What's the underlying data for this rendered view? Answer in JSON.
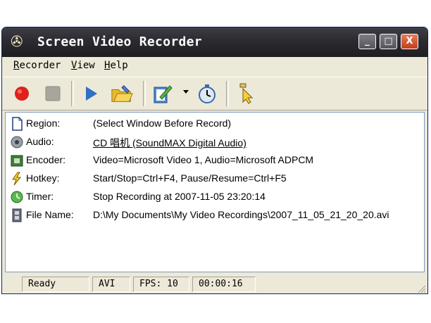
{
  "window": {
    "title": "Screen Video Recorder"
  },
  "menu": {
    "recorder": {
      "accel": "R",
      "rest": "ecorder"
    },
    "view": {
      "accel": "V",
      "rest": "iew"
    },
    "help": {
      "accel": "H",
      "rest": "elp"
    }
  },
  "titlebar_buttons": {
    "minimize": "_",
    "maximize": "□",
    "close": "X"
  },
  "toolbar": {
    "icons": [
      "record-icon",
      "stop-icon",
      "play-icon",
      "open-folder-icon",
      "edit-settings-icon",
      "timer-clock-icon",
      "pointer-cursor-icon"
    ]
  },
  "info": {
    "region": {
      "label": "Region:",
      "value": "(Select Window Before Record)"
    },
    "audio": {
      "label": "Audio:",
      "value": "CD 唱机 (SoundMAX Digital Audio)"
    },
    "encoder": {
      "label": "Encoder:",
      "value": "Video=Microsoft Video 1, Audio=Microsoft ADPCM"
    },
    "hotkey": {
      "label": "Hotkey:",
      "value": "Start/Stop=Ctrl+F4, Pause/Resume=Ctrl+F5"
    },
    "timer": {
      "label": "Timer:",
      "value": "Stop Recording at 2007-11-05 23:20:14"
    },
    "filename": {
      "label": "File Name:",
      "value": "D:\\My Documents\\My Video Recordings\\2007_11_05_21_20_20.avi"
    }
  },
  "status": {
    "state": "Ready",
    "format": "AVI",
    "fps": "FPS: 10",
    "time": "00:00:16"
  },
  "colors": {
    "record": "#e0201c",
    "title_bg": "#2b2b31",
    "window_bg": "#ece9d8"
  }
}
